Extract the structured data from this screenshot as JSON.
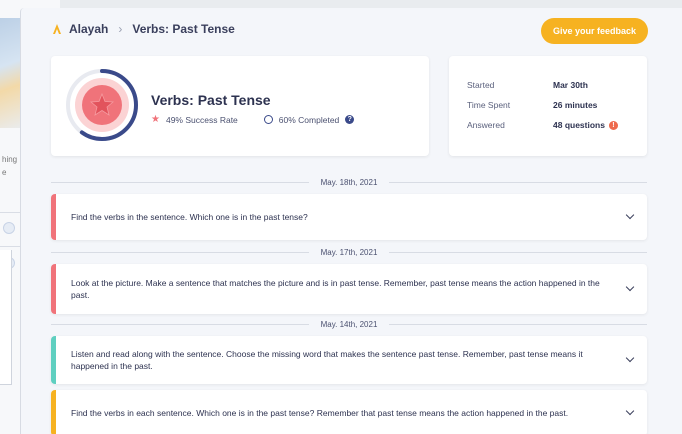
{
  "header": {
    "user_name": "Alayah",
    "page_title": "Verbs: Past Tense",
    "feedback_button": "Give your feedback"
  },
  "summary": {
    "title": "Verbs: Past Tense",
    "success_rate": "49% Success Rate",
    "completed": "60% Completed",
    "completion_fraction": 0.6
  },
  "stats": {
    "started_label": "Started",
    "started_value": "Mar 30th",
    "time_label": "Time Spent",
    "time_value": "26 minutes",
    "answered_label": "Answered",
    "answered_value": "48 questions"
  },
  "background": {
    "fragment_1": "hing",
    "fragment_2": "e"
  },
  "groups": [
    {
      "date": "May. 18th, 2021",
      "questions": [
        {
          "text": "Find the verbs in the sentence. Which one is in the past tense?",
          "color": "#f0737a"
        }
      ]
    },
    {
      "date": "May. 17th, 2021",
      "questions": [
        {
          "text": "Look at the picture. Make a sentence that matches the picture and is in past tense. Remember, past tense means the action happened in the past.",
          "color": "#f0737a"
        }
      ]
    },
    {
      "date": "May. 14th, 2021",
      "questions": [
        {
          "text": "Listen and read along with the sentence. Choose the missing word that makes the sentence past tense. Remember, past tense means it happened in the past.",
          "color": "#5fcfc0"
        },
        {
          "text": "Find the verbs in each sentence. Which one is in the past tense? Remember that past tense means the action happened in the past.",
          "color": "#f6b221"
        }
      ]
    }
  ],
  "colors": {
    "accent": "#f6b221",
    "progress_ring": "#3a4a8a",
    "star_fill": "#f0737a"
  }
}
